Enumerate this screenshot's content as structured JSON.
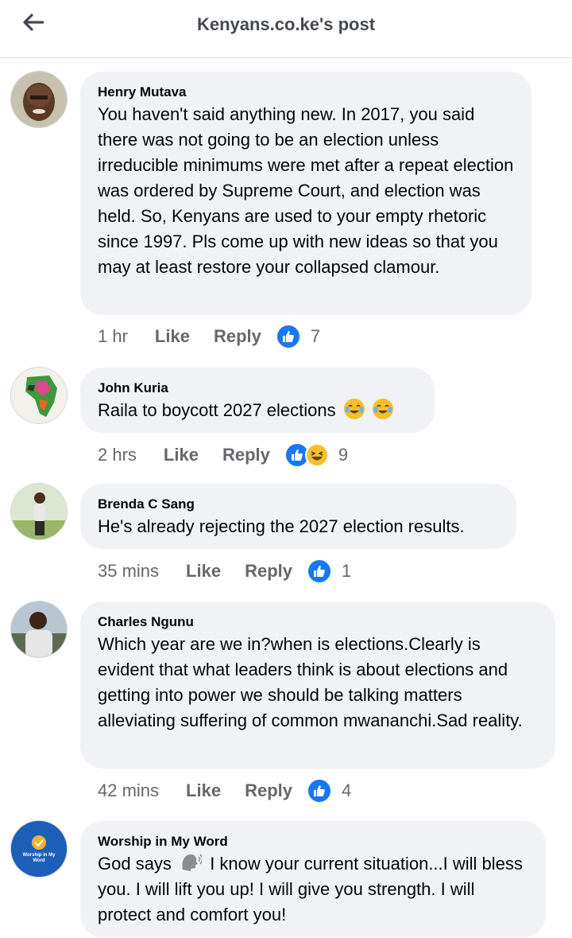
{
  "header": {
    "title": "Kenyans.co.ke's post"
  },
  "comments": [
    {
      "author": "Henry Mutava",
      "text": "You haven't said anything new. In 2017, you said there was not going to be an election unless irreducible minimums were met after a repeat election was ordered by Supreme Court, and election was held. So, Kenyans are used to your empty rhetoric since 1997. Pls come up with new ideas so that you may at least restore your collapsed clamour.",
      "time": "1 hr",
      "like_label": "Like",
      "reply_label": "Reply",
      "reaction_count": "7",
      "reactions": [
        "like-icon"
      ]
    },
    {
      "author": "John Kuria",
      "text": "Raila to boycott 2027 elections",
      "time": "2 hrs",
      "like_label": "Like",
      "reply_label": "Reply",
      "reaction_count": "9",
      "reactions": [
        "like-icon",
        "haha-icon"
      ]
    },
    {
      "author": "Brenda C Sang",
      "text": "He's already rejecting the 2027 election results.",
      "time": "35 mins",
      "like_label": "Like",
      "reply_label": "Reply",
      "reaction_count": "1",
      "reactions": [
        "like-icon"
      ]
    },
    {
      "author": "Charles Ngunu",
      "text": "Which year are we in?when is elections.Clearly is evident that what leaders think is about elections and getting into power we should be talking matters alleviating suffering of common mwananchi.Sad reality.",
      "time": "42 mins",
      "like_label": "Like",
      "reply_label": "Reply",
      "reaction_count": "4",
      "reactions": [
        "like-icon"
      ]
    },
    {
      "author": "Worship in My Word",
      "text_before": "God says",
      "text_after": "I know your current situation...I will bless you. I will lift you up! I will give you strength. I will protect and comfort you!",
      "avatar_text": "Worship in My Word"
    }
  ],
  "colors": {
    "accent": "#1877f2",
    "bubble": "#f0f2f5",
    "meta": "#65676b",
    "haha": "#f7c02b"
  }
}
